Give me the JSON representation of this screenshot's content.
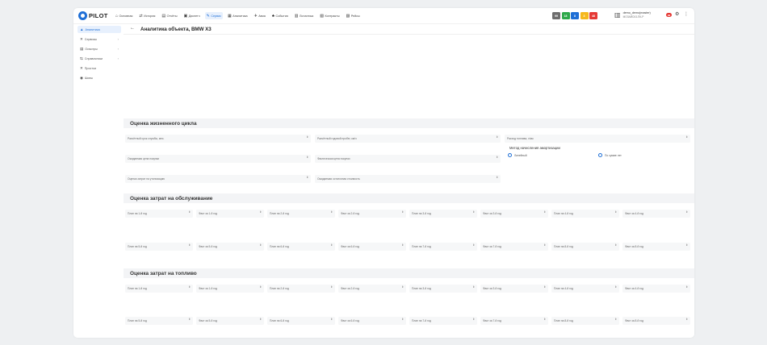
{
  "brand": {
    "logo_text": "PILOT"
  },
  "topnav": [
    {
      "icon": "home-icon",
      "glyph": "⌂",
      "label": "Основная",
      "active": false
    },
    {
      "icon": "route-icon",
      "glyph": "⇄",
      "label": "История",
      "active": false
    },
    {
      "icon": "report-icon",
      "glyph": "▤",
      "label": "Отчёты",
      "active": false
    },
    {
      "icon": "dispatch-icon",
      "glyph": "▣",
      "label": "Диспетч",
      "active": false
    },
    {
      "icon": "service-icon",
      "glyph": "✎",
      "label": "Сервис",
      "active": true
    },
    {
      "icon": "analytics-icon",
      "glyph": "▦",
      "label": "Аналитика",
      "active": false
    },
    {
      "icon": "plane-icon",
      "glyph": "✈",
      "label": "Авиа",
      "active": false
    },
    {
      "icon": "bell-icon",
      "glyph": "♣",
      "label": "События",
      "active": false
    },
    {
      "icon": "garage-icon",
      "glyph": "▥",
      "label": "Логистика",
      "active": false
    },
    {
      "icon": "contract-icon",
      "glyph": "▧",
      "label": "Контракты",
      "active": false
    },
    {
      "icon": "trip-icon",
      "glyph": "▨",
      "label": "Рейсы",
      "active": false
    }
  ],
  "badges": [
    {
      "label": "99",
      "color": "#6d6d6d"
    },
    {
      "label": "18",
      "color": "#2ea84a"
    },
    {
      "label": "8",
      "color": "#1f6fd6"
    },
    {
      "label": "3",
      "color": "#f5b81d"
    },
    {
      "label": "48",
      "color": "#e53935"
    }
  ],
  "user": {
    "name": "demo_demo(master)",
    "sub": "МОЗАЙСК3-ПК-Р"
  },
  "notifications": "99",
  "sidebar": [
    {
      "icon": "analytics-icon",
      "glyph": "▲",
      "label": "Аналитика",
      "active": true,
      "chev": false
    },
    {
      "icon": "services-icon",
      "glyph": "✕",
      "label": "Сервисы",
      "active": false,
      "chev": true
    },
    {
      "icon": "inspection-icon",
      "glyph": "▤",
      "label": "Осмотры",
      "active": false,
      "chev": true
    },
    {
      "icon": "directory-icon",
      "glyph": "⇆",
      "label": "Справочники",
      "active": false,
      "chev": true
    },
    {
      "icon": "downtime-icon",
      "glyph": "✕",
      "label": "Простои",
      "active": false,
      "chev": false
    },
    {
      "icon": "tire-icon",
      "glyph": "◉",
      "label": "Шины",
      "active": false,
      "chev": false
    }
  ],
  "collapse_glyph": "«",
  "header": {
    "back_glyph": "←",
    "title": "Аналитика объекта, BMW X3"
  },
  "lifecycle": {
    "title": "Оценка жизненного цикла",
    "fields": [
      "Расчётный срок службы, мес.",
      "Расчётный годовой пробег, км/ч",
      "Расход топлива, л/км",
      "Ожидаемая цена покупки",
      "Фактическая цена покупки",
      "Оценка затрат на утилизацию",
      "Ожидаемая остаточная стоимость"
    ],
    "amort_title": "Метод начисления амортизации",
    "amort_options": [
      "Линейный",
      "По сумме лет"
    ]
  },
  "maintenance": {
    "title": "Оценка затрат на обслуживание",
    "row1": [
      "План на 1-й год",
      "Факт за 1-й год",
      "План на 2-й год",
      "Факт за 2-й год",
      "План на 3-й год",
      "Факт за 3-й год",
      "План на 4-й год",
      "Факт за 4-й год"
    ],
    "row2": [
      "План на 5-й год",
      "Факт за 5-й год",
      "План на 6-й год",
      "Факт за 6-й год",
      "План на 7-й год",
      "Факт за 7-й год",
      "План на 8-й год",
      "Факт за 8-й год"
    ]
  },
  "fuel": {
    "title": "Оценка затрат на топливо",
    "row1": [
      "План на 1-й год",
      "Факт за 1-й год",
      "План на 2-й год",
      "Факт за 2-й год",
      "План на 3-й год",
      "Факт за 3-й год",
      "План на 4-й год",
      "Факт за 4-й год"
    ],
    "row2": [
      "План на 5-й год",
      "Факт за 5-й год",
      "План на 6-й год",
      "Факт за 6-й год",
      "План на 7-й год",
      "Факт за 7-й год",
      "План на 8-й год",
      "Факт за 8-й год"
    ]
  },
  "spinner_glyph": "⇕"
}
